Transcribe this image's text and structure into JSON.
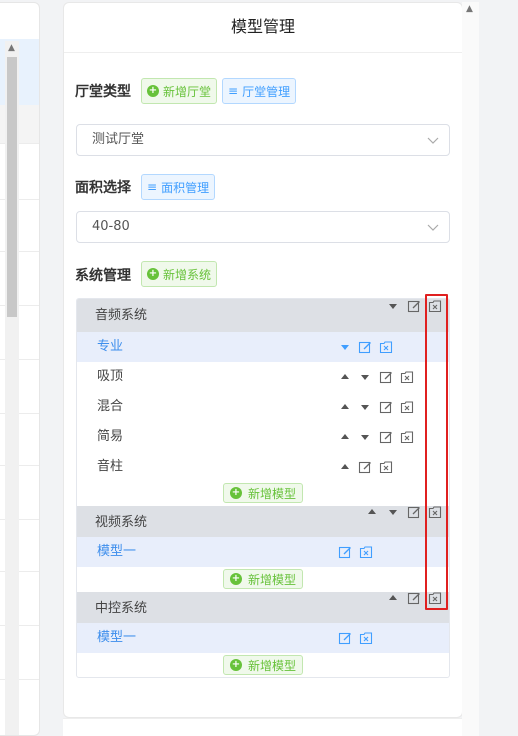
{
  "panel": {
    "title": "模型管理",
    "hall_type": {
      "label": "厅堂类型",
      "add_label": "新增厅堂",
      "manage_label": "厅堂管理",
      "selected": "测试厅堂"
    },
    "area": {
      "label": "面积选择",
      "manage_label": "面积管理",
      "selected": "40-80"
    },
    "system": {
      "label": "系统管理",
      "add_label": "新增系统"
    }
  },
  "systems": [
    {
      "name": "音频系统",
      "models": [
        "专业",
        "吸顶",
        "混合",
        "简易",
        "音柱"
      ],
      "add_model_label": "新增模型"
    },
    {
      "name": "视频系统",
      "models": [
        "模型一"
      ],
      "add_model_label": "新增模型"
    },
    {
      "name": "中控系统",
      "models": [
        "模型一"
      ],
      "add_model_label": "新增模型"
    }
  ],
  "colors": {
    "accent_blue": "#409eff",
    "accent_green": "#67c23a",
    "highlight_red": "#e02020",
    "header_gray": "#dde0e5",
    "active_row": "#e8eefb"
  }
}
